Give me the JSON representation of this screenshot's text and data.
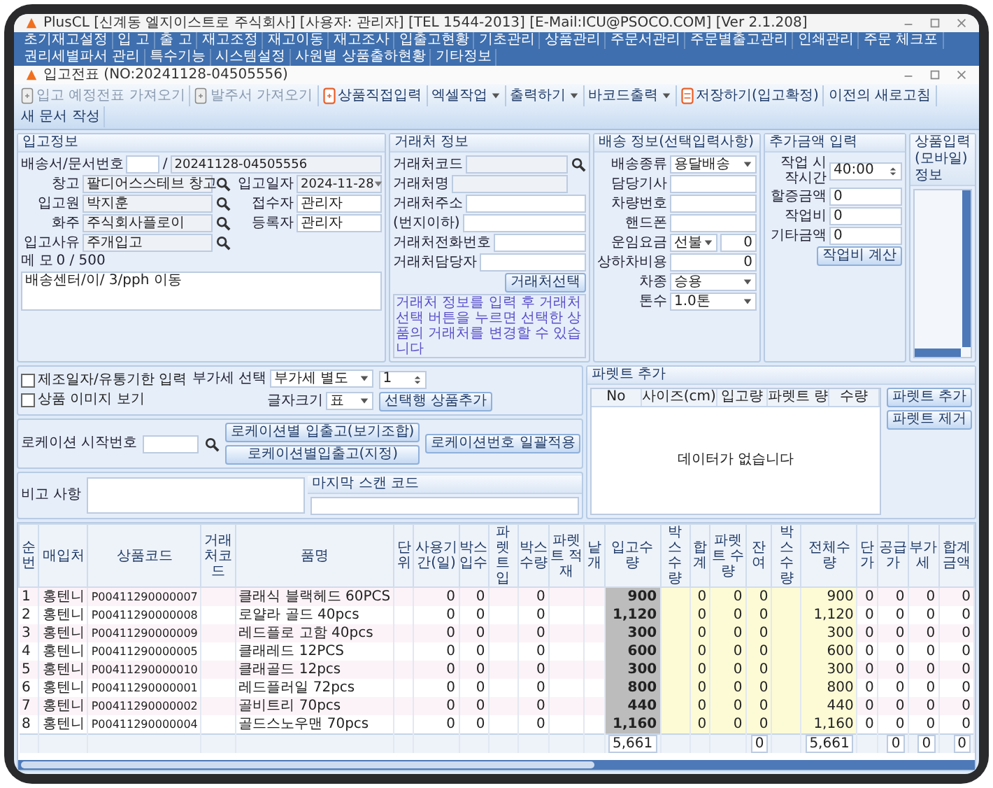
{
  "app_window": {
    "title": "PlusCL [신계동 엘지이스트로 주식회사] [사용자: 관리자] [TEL 1544-2013] [E-Mail:ICU@PSOCO.COM] [Ver 2.1.208]"
  },
  "menu": [
    "초기재고설정",
    "입 고",
    "출 고",
    "재고조정",
    "재고이동",
    "재고조사",
    "입출고현황",
    "기초관리",
    "상품관리",
    "주문서관리",
    "주문별출고관리",
    "인쇄관리",
    "주문 체크포",
    "권리세별파서 관리",
    "특수기능",
    "시스템설정",
    "사원별 상품출하현황",
    "기타정보"
  ],
  "document_window": {
    "title": "입고전표 (NO:20241128-04505556)"
  },
  "toolbar": [
    {
      "label": "입고 예정전표 가져오기",
      "kind": "doc",
      "disabled": true
    },
    {
      "label": "발주서 가져오기",
      "kind": "doc",
      "disabled": true
    },
    {
      "label": "상품직접입력",
      "kind": "add",
      "disabled": false
    },
    {
      "label": "엑셀작업",
      "kind": "menu",
      "disabled": false
    },
    {
      "label": "출력하기",
      "kind": "menu",
      "disabled": false
    },
    {
      "label": "바코드출력",
      "kind": "menu",
      "disabled": false
    },
    {
      "label": "저장하기(입고확정)",
      "kind": "save",
      "disabled": false
    },
    {
      "label": "이전의 새로고침",
      "kind": "text",
      "disabled": false
    },
    {
      "label": "새 문서 작성",
      "kind": "text",
      "disabled": false
    }
  ],
  "receipt_info": {
    "title": "입고정보",
    "doc_label": "배송서/문서번호",
    "doc_separator": "/",
    "doc_no": "20241128-04505556",
    "left_fields": [
      {
        "label": "창고",
        "value": "팔디어스스테브 창고"
      },
      {
        "label": "입고원",
        "value": "박지훈"
      },
      {
        "label": "화주",
        "value": "주식회사플로이"
      },
      {
        "label": "입고사유",
        "value": "주개입고"
      }
    ],
    "right_fields": [
      {
        "label": "입고일자",
        "value": "2024-11-28",
        "kind": "date"
      },
      {
        "label": "접수자",
        "value": "관리자",
        "kind": "input"
      },
      {
        "label": "등록자",
        "value": "관리자",
        "kind": "input"
      }
    ],
    "memo_label": "메 모",
    "memo_count": "0 / 500",
    "memo": "배송센터/이/ 3/pph 이동"
  },
  "client_info": {
    "title": "거래처 정보",
    "fields": [
      {
        "label": "거래처코드",
        "kind": "search"
      },
      {
        "label": "거래처명",
        "kind": "readonly"
      },
      {
        "label": "거래처주소",
        "kind": "input"
      },
      {
        "label": "(번지이하)",
        "kind": "input"
      },
      {
        "label": "거래처전화번호",
        "kind": "input"
      },
      {
        "label": "거래처담당자",
        "kind": "input"
      }
    ],
    "button": "거래처선택",
    "note": "거래처 정보를 입력 후 거래처선택 버튼을 누르면 선택한 상품의 거래처를 변경할 수 있습니다"
  },
  "delivery_info": {
    "title": "배송 정보(선택입력사항)",
    "fields": [
      {
        "label": "배송종류",
        "value": "용달배송",
        "kind": "select"
      },
      {
        "label": "담당기사",
        "kind": "input"
      },
      {
        "label": "차량번호",
        "kind": "input"
      },
      {
        "label": "핸드폰",
        "kind": "input"
      },
      {
        "label": "운임요금",
        "value": "선불",
        "extra": "0",
        "kind": "select-amount"
      },
      {
        "label": "상하차비용",
        "value": "0",
        "kind": "amount"
      },
      {
        "label": "차종",
        "value": "승용",
        "kind": "select"
      },
      {
        "label": "톤수",
        "value": "1.0톤",
        "kind": "select"
      }
    ]
  },
  "extra_cost": {
    "title": "추가금액 입력",
    "fields": [
      {
        "label": "작업 시작시간",
        "value": "40:00",
        "kind": "spin"
      },
      {
        "label": "할증금액",
        "value": "0",
        "kind": "input"
      },
      {
        "label": "작업비",
        "value": "0",
        "kind": "input"
      },
      {
        "label": "기타금액",
        "value": "0",
        "kind": "input"
      }
    ],
    "button": "작업비 계산"
  },
  "mobile_input": {
    "title": "상품입력(모바일)정보"
  },
  "options": {
    "checkboxes": [
      {
        "label": "제조일자/유통기한 입력",
        "checked": false
      },
      {
        "label": "상품 이미지 보기",
        "checked": false
      }
    ],
    "tax_label": "부가세 선택",
    "tax_value": "부가세 별도",
    "count_value": "1",
    "add_button": "선택행 상품추가",
    "font_label": "글자크기",
    "font_value": "표"
  },
  "location": {
    "label": "로케이션 시작번호",
    "buttons": [
      "로케이션별 입출고(보기조합)",
      "로케이션별입출고(지정)",
      "로케이션번호 일괄적용"
    ]
  },
  "remarks": {
    "label": "비고 사항",
    "last_scan_label": "마지막 스캔 코드"
  },
  "pallet": {
    "title": "파렛트 추가",
    "columns": [
      "No",
      "사이즈(cm)",
      "입고량",
      "파렛트 량",
      "수량"
    ],
    "empty_message": "데이터가 없습니다",
    "buttons": [
      "파렛트 추가",
      "파렛트 제거"
    ]
  },
  "items_table": {
    "columns": [
      {
        "label": "순번",
        "kind": "text"
      },
      {
        "label": "매입처",
        "kind": "text"
      },
      {
        "label": "상품코드",
        "kind": "code"
      },
      {
        "label": "거래처코드",
        "kind": "text"
      },
      {
        "label": "품명",
        "kind": "name"
      },
      {
        "label": "단위",
        "kind": "num"
      },
      {
        "label": "사용기간(일)",
        "kind": "num"
      },
      {
        "label": "박스입수",
        "kind": "num"
      },
      {
        "label": "파렛트입",
        "kind": "num"
      },
      {
        "label": "박스 수량",
        "kind": "num"
      },
      {
        "label": "파렛트 적재",
        "kind": "num"
      },
      {
        "label": "낱개",
        "kind": "num"
      },
      {
        "label": "입고수량",
        "kind": "key",
        "total": "5,661"
      },
      {
        "label": "박스수량",
        "kind": "edit"
      },
      {
        "label": "합계",
        "kind": "edit"
      },
      {
        "label": "파렛트 수량",
        "kind": "edit"
      },
      {
        "label": "잔여",
        "kind": "edit",
        "total": "0"
      },
      {
        "label": "박스수량",
        "kind": "edit"
      },
      {
        "label": "전체수량",
        "kind": "edit",
        "total": "5,661"
      },
      {
        "label": "단가",
        "kind": "num"
      },
      {
        "label": "공급가",
        "kind": "num",
        "total": "0"
      },
      {
        "label": "부가세",
        "kind": "num",
        "total": "0"
      },
      {
        "label": "합계금액",
        "kind": "num",
        "total": "0"
      }
    ],
    "rows": [
      [
        "1",
        "홍텐니",
        "P00411290000007",
        "",
        "클래식 블랙헤드 60PCS",
        "",
        "0",
        "0",
        "",
        "0",
        "",
        "",
        "900",
        "",
        "0",
        "0",
        "0",
        "",
        "900",
        "0",
        "0",
        "0",
        "0"
      ],
      [
        "2",
        "홍텐니",
        "P00411290000008",
        "",
        "로얄라 골드 40pcs",
        "",
        "0",
        "0",
        "",
        "0",
        "",
        "",
        "1,120",
        "",
        "0",
        "0",
        "0",
        "",
        "1,120",
        "0",
        "0",
        "0",
        "0"
      ],
      [
        "3",
        "홍텐니",
        "P00411290000009",
        "",
        "레드플로 고함 40pcs",
        "",
        "0",
        "0",
        "",
        "0",
        "",
        "",
        "300",
        "",
        "0",
        "0",
        "0",
        "",
        "300",
        "0",
        "0",
        "0",
        "0"
      ],
      [
        "4",
        "홍텐니",
        "P00411290000005",
        "",
        "클래레드 12PCS",
        "",
        "0",
        "0",
        "",
        "0",
        "",
        "",
        "600",
        "",
        "0",
        "0",
        "0",
        "",
        "600",
        "0",
        "0",
        "0",
        "0"
      ],
      [
        "5",
        "홍텐니",
        "P00411290000010",
        "",
        "클래골드 12pcs",
        "",
        "0",
        "0",
        "",
        "0",
        "",
        "",
        "300",
        "",
        "0",
        "0",
        "0",
        "",
        "300",
        "0",
        "0",
        "0",
        "0"
      ],
      [
        "6",
        "홍텐니",
        "P00411290000001",
        "",
        "레드플러일 72pcs",
        "",
        "0",
        "0",
        "",
        "0",
        "",
        "",
        "800",
        "",
        "0",
        "0",
        "0",
        "",
        "800",
        "0",
        "0",
        "0",
        "0"
      ],
      [
        "7",
        "홍텐니",
        "P00411290000002",
        "",
        "골비트리 70pcs",
        "",
        "0",
        "0",
        "",
        "0",
        "",
        "",
        "440",
        "",
        "0",
        "0",
        "0",
        "",
        "440",
        "0",
        "0",
        "0",
        "0"
      ],
      [
        "8",
        "홍텐니",
        "P00411290000004",
        "",
        "골드스노우맨 70pcs",
        "",
        "0",
        "0",
        "",
        "0",
        "",
        "",
        "1,160",
        "",
        "0",
        "0",
        "0",
        "",
        "1,160",
        "0",
        "0",
        "0",
        "0"
      ]
    ]
  }
}
